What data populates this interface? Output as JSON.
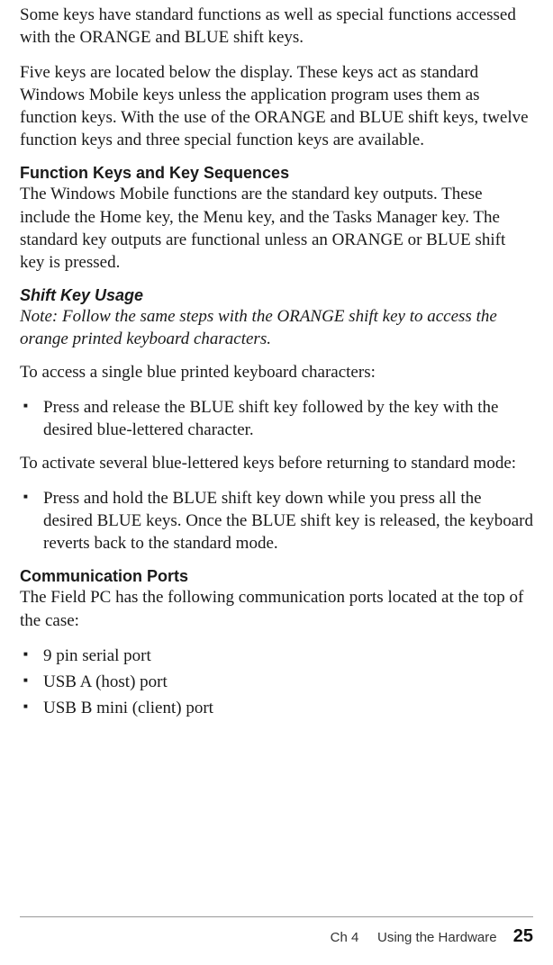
{
  "paragraphs": {
    "p1": "Some keys have standard functions as well as special functions accessed with the ORANGE and BLUE shift keys.",
    "p2": "Five keys are located below the display. These keys act as standard Windows Mobile keys unless the application program uses them as function keys. With the use of the ORANGE and BLUE shift keys, twelve function keys and three special function keys are available.",
    "h1": "Function Keys and Key Sequences",
    "p3": "The Windows Mobile functions are the standard key outputs. These include the Home key, the Menu key, and the Tasks Manager key. The standard key outputs are functional unless an ORANGE or BLUE shift key is pressed.",
    "h2": "Shift Key Usage",
    "note": "Note: Follow the same steps with the ORANGE shift key to access the orange printed keyboard characters.",
    "p4": "To access a single blue printed keyboard characters:",
    "b1": "Press and release the BLUE shift key followed by the key with the desired blue-lettered character.",
    "p5": "To activate several blue-lettered keys before returning to standard mode:",
    "b2": "Press and hold the BLUE shift key down while you press all the desired BLUE keys. Once the BLUE shift key is released, the keyboard reverts back to the standard mode.",
    "h3": "Communication Ports",
    "p6": "The Field PC has the following communication ports located at the top of the case:",
    "ports": {
      "a": "9 pin serial port",
      "b": "USB A (host) port",
      "c": "USB B mini (client) port"
    }
  },
  "footer": {
    "chapter_label": "Ch 4",
    "chapter_title": "Using the Hardware",
    "page_number": "25"
  }
}
